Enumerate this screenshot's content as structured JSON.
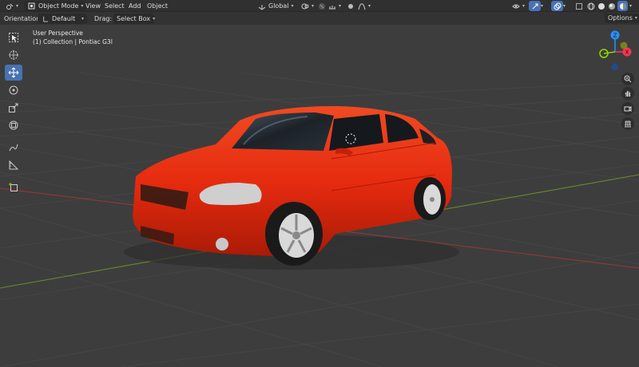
{
  "header": {
    "mode_label": "Object Mode",
    "menus": [
      "View",
      "Select",
      "Add",
      "Object"
    ],
    "transform_orientation": "Global"
  },
  "tool_options": {
    "orientation_label": "Orientation:",
    "orientation_value": "Default",
    "drag_label": "Drag:",
    "drag_value": "Select Box",
    "options_label": "Options"
  },
  "viewport": {
    "perspective_label": "User Perspective",
    "collection_label": "(1) Collection | Pontiac G3I"
  },
  "gizmo": {
    "x_label": "X",
    "z_label": "Z",
    "x_color": "#ff3352",
    "y_color": "#8bdc00",
    "z_color": "#2890ff"
  },
  "colors": {
    "active_tool": "#4772b3",
    "car_body": "#e62b0f",
    "x_axis": "#9a3838",
    "y_axis": "#6a8a2a"
  },
  "toolbar_tools": [
    "select-box-icon",
    "cursor-icon",
    "move-icon",
    "rotate-icon",
    "scale-icon",
    "transform-icon",
    "annotate-icon",
    "measure-icon",
    "add-cube-icon"
  ],
  "nav_buttons": [
    "zoom-icon",
    "pan-hand-icon",
    "camera-icon",
    "grid-view-icon"
  ]
}
